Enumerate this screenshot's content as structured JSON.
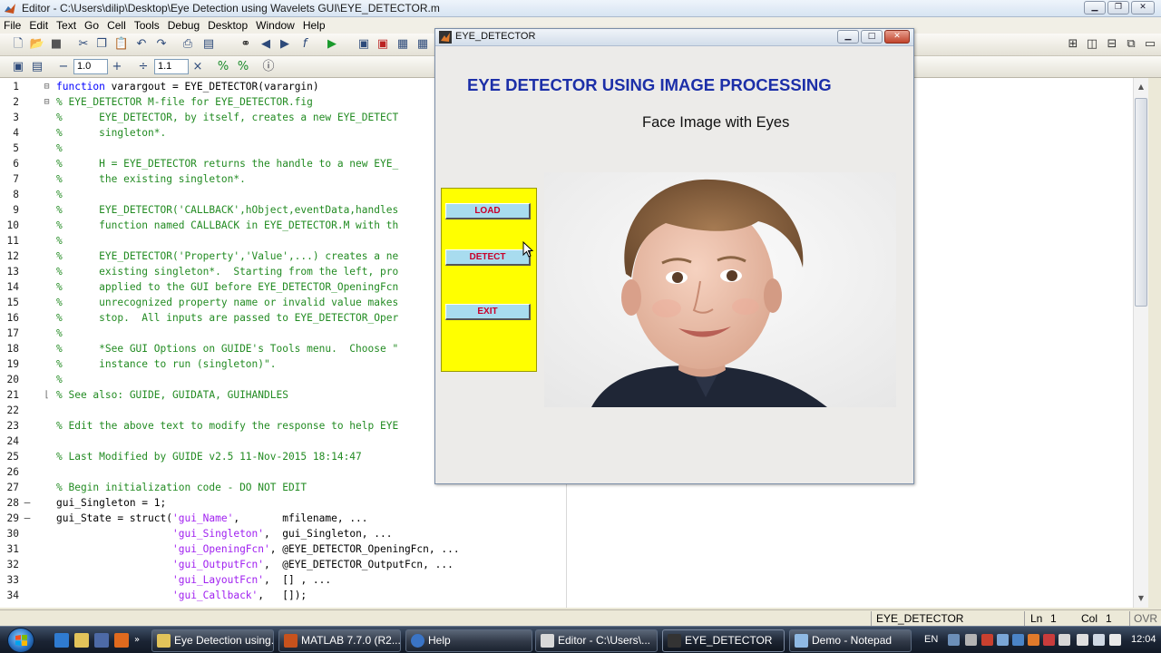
{
  "editor": {
    "title": "Editor - C:\\Users\\dilip\\Desktop\\Eye Detection using Wavelets GUI\\EYE_DETECTOR.m",
    "window_controls": {
      "minimize": "▁",
      "restore": "❐",
      "close": "✕"
    },
    "menu": [
      "File",
      "Edit",
      "Text",
      "Go",
      "Cell",
      "Tools",
      "Debug",
      "Desktop",
      "Window",
      "Help"
    ],
    "toolbar2": {
      "minus": "−",
      "cell_value_1": "1.0",
      "plus": "+",
      "divide": "÷",
      "cell_value_2": "1.1",
      "times": "×"
    },
    "code_lines": [
      {
        "n": "1",
        "mark": "",
        "fold": "⊟",
        "code": [
          [
            "kw",
            "function "
          ],
          [
            "txt",
            "varargout = EYE_DETECTOR(varargin)"
          ]
        ]
      },
      {
        "n": "2",
        "mark": "",
        "fold": "⊟",
        "code": [
          [
            "com",
            "% EYE_DETECTOR M-file for EYE_DETECTOR.fig"
          ]
        ]
      },
      {
        "n": "3",
        "mark": "",
        "fold": "",
        "code": [
          [
            "com",
            "%      EYE_DETECTOR, by itself, creates a new EYE_DETECT"
          ]
        ]
      },
      {
        "n": "4",
        "mark": "",
        "fold": "",
        "code": [
          [
            "com",
            "%      singleton*."
          ]
        ]
      },
      {
        "n": "5",
        "mark": "",
        "fold": "",
        "code": [
          [
            "com",
            "%"
          ]
        ]
      },
      {
        "n": "6",
        "mark": "",
        "fold": "",
        "code": [
          [
            "com",
            "%      H = EYE_DETECTOR returns the handle to a new EYE_"
          ]
        ]
      },
      {
        "n": "7",
        "mark": "",
        "fold": "",
        "code": [
          [
            "com",
            "%      the existing singleton*."
          ]
        ]
      },
      {
        "n": "8",
        "mark": "",
        "fold": "",
        "code": [
          [
            "com",
            "%"
          ]
        ]
      },
      {
        "n": "9",
        "mark": "",
        "fold": "",
        "code": [
          [
            "com",
            "%      EYE_DETECTOR('CALLBACK',hObject,eventData,handles"
          ]
        ]
      },
      {
        "n": "10",
        "mark": "",
        "fold": "",
        "code": [
          [
            "com",
            "%      function named CALLBACK in EYE_DETECTOR.M with th"
          ]
        ]
      },
      {
        "n": "11",
        "mark": "",
        "fold": "",
        "code": [
          [
            "com",
            "%"
          ]
        ]
      },
      {
        "n": "12",
        "mark": "",
        "fold": "",
        "code": [
          [
            "com",
            "%      EYE_DETECTOR('Property','Value',...) creates a ne"
          ]
        ]
      },
      {
        "n": "13",
        "mark": "",
        "fold": "",
        "code": [
          [
            "com",
            "%      existing singleton*.  Starting from the left, pro"
          ]
        ]
      },
      {
        "n": "14",
        "mark": "",
        "fold": "",
        "code": [
          [
            "com",
            "%      applied to the GUI before EYE_DETECTOR_OpeningFcn"
          ]
        ]
      },
      {
        "n": "15",
        "mark": "",
        "fold": "",
        "code": [
          [
            "com",
            "%      unrecognized property name or invalid value makes"
          ]
        ]
      },
      {
        "n": "16",
        "mark": "",
        "fold": "",
        "code": [
          [
            "com",
            "%      stop.  All inputs are passed to EYE_DETECTOR_Oper"
          ]
        ]
      },
      {
        "n": "17",
        "mark": "",
        "fold": "",
        "code": [
          [
            "com",
            "%"
          ]
        ]
      },
      {
        "n": "18",
        "mark": "",
        "fold": "",
        "code": [
          [
            "com",
            "%      *See GUI Options on GUIDE's Tools menu.  Choose \""
          ]
        ]
      },
      {
        "n": "19",
        "mark": "",
        "fold": "",
        "code": [
          [
            "com",
            "%      instance to run (singleton)\"."
          ]
        ]
      },
      {
        "n": "20",
        "mark": "",
        "fold": "",
        "code": [
          [
            "com",
            "%"
          ]
        ]
      },
      {
        "n": "21",
        "mark": "",
        "fold": "⌊",
        "code": [
          [
            "com",
            "% See also: GUIDE, GUIDATA, GUIHANDLES"
          ]
        ]
      },
      {
        "n": "22",
        "mark": "",
        "fold": "",
        "code": []
      },
      {
        "n": "23",
        "mark": "",
        "fold": "",
        "code": [
          [
            "com",
            "% Edit the above text to modify the response to help EYE"
          ]
        ]
      },
      {
        "n": "24",
        "mark": "",
        "fold": "",
        "code": []
      },
      {
        "n": "25",
        "mark": "",
        "fold": "",
        "code": [
          [
            "com",
            "% Last Modified by GUIDE v2.5 11-Nov-2015 18:14:47"
          ]
        ]
      },
      {
        "n": "26",
        "mark": "",
        "fold": "",
        "code": []
      },
      {
        "n": "27",
        "mark": "",
        "fold": "",
        "code": [
          [
            "com",
            "% Begin initialization code - DO NOT EDIT"
          ]
        ]
      },
      {
        "n": "28",
        "mark": "–",
        "fold": "",
        "code": [
          [
            "txt",
            "gui_Singleton = 1;"
          ]
        ]
      },
      {
        "n": "29",
        "mark": "–",
        "fold": "",
        "code": [
          [
            "txt",
            "gui_State = struct("
          ],
          [
            "str",
            "'gui_Name'"
          ],
          [
            "txt",
            ",       mfilename, ..."
          ]
        ]
      },
      {
        "n": "30",
        "mark": "",
        "fold": "",
        "code": [
          [
            "txt",
            "                   "
          ],
          [
            "str",
            "'gui_Singleton'"
          ],
          [
            "txt",
            ",  gui_Singleton, ..."
          ]
        ]
      },
      {
        "n": "31",
        "mark": "",
        "fold": "",
        "code": [
          [
            "txt",
            "                   "
          ],
          [
            "str",
            "'gui_OpeningFcn'"
          ],
          [
            "txt",
            ", @EYE_DETECTOR_OpeningFcn, ..."
          ]
        ]
      },
      {
        "n": "32",
        "mark": "",
        "fold": "",
        "code": [
          [
            "txt",
            "                   "
          ],
          [
            "str",
            "'gui_OutputFcn'"
          ],
          [
            "txt",
            ",  @EYE_DETECTOR_OutputFcn, ..."
          ]
        ]
      },
      {
        "n": "33",
        "mark": "",
        "fold": "",
        "code": [
          [
            "txt",
            "                   "
          ],
          [
            "str",
            "'gui_LayoutFcn'"
          ],
          [
            "txt",
            ",  [] , ..."
          ]
        ]
      },
      {
        "n": "34",
        "mark": "",
        "fold": "",
        "code": [
          [
            "txt",
            "                   "
          ],
          [
            "str",
            "'gui_Callback'"
          ],
          [
            "txt",
            ",   []);"
          ]
        ]
      }
    ],
    "status": {
      "window_name": "EYE_DETECTOR",
      "ln_label": "Ln",
      "ln_value": "1",
      "col_label": "Col",
      "col_value": "1",
      "mode": "OVR"
    }
  },
  "figure": {
    "title": "EYE_DETECTOR",
    "heading": "EYE DETECTOR USING IMAGE PROCESSING",
    "axes_title": "Face Image with Eyes",
    "buttons": {
      "load": "LOAD",
      "detect": "DETECT",
      "exit": "EXIT"
    },
    "colors": {
      "heading": "#1c2fa8",
      "panel": "#ffff00",
      "button_face": "#a8dcef",
      "button_text": "#c8002b"
    }
  },
  "taskbar": {
    "tasks": [
      "Eye Detection using...",
      "MATLAB 7.7.0 (R2...",
      "Help",
      "Editor - C:\\Users\\...",
      "EYE_DETECTOR",
      "Demo - Notepad"
    ],
    "active_task": "EYE_DETECTOR",
    "language": "EN",
    "clock": "12:04"
  }
}
